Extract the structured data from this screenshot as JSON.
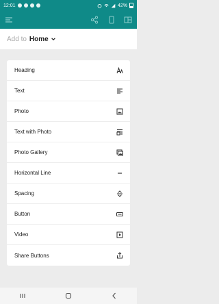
{
  "status_bar": {
    "time": "12:01",
    "battery": "42%"
  },
  "toolbar": {
    "menu_icon": "hamburger-icon",
    "actions": [
      "share-icon",
      "phone-preview-icon",
      "layout-icon"
    ]
  },
  "sheet": {
    "add_to_label": "Add to",
    "target_page": "Home"
  },
  "menu_items": [
    {
      "label": "Heading",
      "icon": "heading-icon"
    },
    {
      "label": "Text",
      "icon": "text-align-icon"
    },
    {
      "label": "Photo",
      "icon": "image-icon"
    },
    {
      "label": "Text with Photo",
      "icon": "text-photo-icon"
    },
    {
      "label": "Photo Gallery",
      "icon": "gallery-icon"
    },
    {
      "label": "Horizontal Line",
      "icon": "horizontal-line-icon"
    },
    {
      "label": "Spacing",
      "icon": "spacing-icon"
    },
    {
      "label": "Button",
      "icon": "button-icon"
    },
    {
      "label": "Video",
      "icon": "video-icon"
    },
    {
      "label": "Share Buttons",
      "icon": "share-out-icon"
    }
  ],
  "colors": {
    "toolbar": "#0f8a88",
    "background": "#ececec",
    "card": "#ffffff"
  }
}
